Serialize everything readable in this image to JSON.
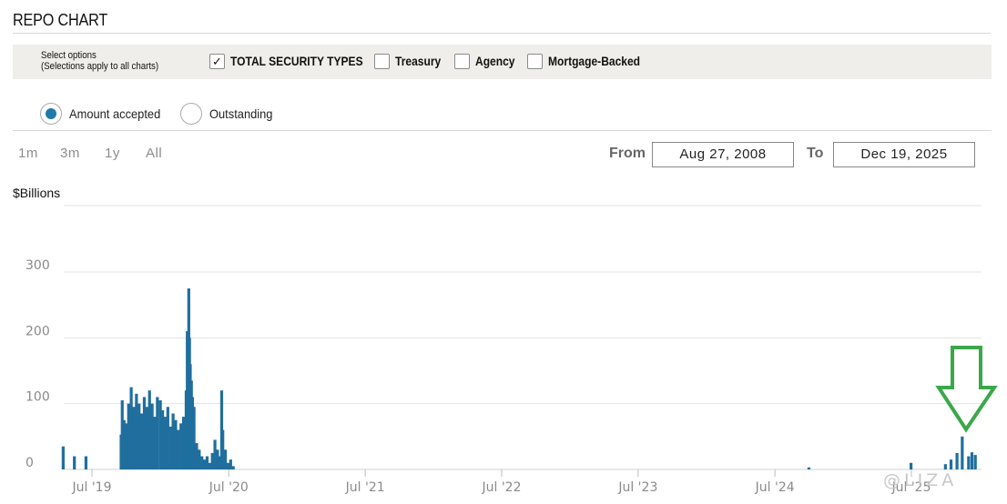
{
  "header": {
    "title": "REPO CHART"
  },
  "options": {
    "hint_line1": "Select options",
    "hint_line2": "(Selections apply to all charts)",
    "checkboxes": [
      {
        "label": "TOTAL SECURITY TYPES",
        "checked": true
      },
      {
        "label": "Treasury",
        "checked": false
      },
      {
        "label": "Agency",
        "checked": false
      },
      {
        "label": "Mortgage-Backed",
        "checked": false
      }
    ]
  },
  "view": {
    "radios": [
      {
        "label": "Amount accepted",
        "selected": true
      },
      {
        "label": "Outstanding",
        "selected": false
      }
    ]
  },
  "range": {
    "buttons": [
      "1m",
      "3m",
      "1y",
      "All"
    ],
    "from_label": "From",
    "from_value": "Aug 27, 2008",
    "to_label": "To",
    "to_value": "Dec 19, 2025"
  },
  "colors": {
    "bar": "#1f6e9e",
    "accent": "#1f7aa8",
    "arrow": "#3aa84a",
    "grid": "#e3e3e3"
  },
  "watermark": "@LIZA",
  "chart_data": {
    "type": "bar",
    "title": "",
    "ylabel": "$Billions",
    "ylim": [
      0,
      300
    ],
    "yticks": [
      0,
      100,
      200,
      300
    ],
    "x_tick_labels": [
      "Jul '19",
      "Jul '20",
      "Jul '21",
      "Jul '22",
      "Jul '23",
      "Jul '24",
      "Jul '25"
    ],
    "x_tick_dates": [
      "2019-07-01",
      "2020-07-01",
      "2021-07-01",
      "2022-07-01",
      "2023-07-01",
      "2024-07-01",
      "2025-07-01"
    ],
    "x": [
      "2019-04-15",
      "2019-05-15",
      "2019-06-15",
      "2019-09-17",
      "2019-09-20",
      "2019-09-25",
      "2019-10-01",
      "2019-10-07",
      "2019-10-14",
      "2019-10-21",
      "2019-10-28",
      "2019-11-04",
      "2019-11-11",
      "2019-11-18",
      "2019-11-25",
      "2019-12-02",
      "2019-12-09",
      "2019-12-16",
      "2019-12-23",
      "2019-12-31",
      "2020-01-06",
      "2020-01-13",
      "2020-01-20",
      "2020-01-27",
      "2020-02-03",
      "2020-02-10",
      "2020-02-17",
      "2020-02-24",
      "2020-03-02",
      "2020-03-09",
      "2020-03-12",
      "2020-03-16",
      "2020-03-18",
      "2020-03-20",
      "2020-03-23",
      "2020-03-26",
      "2020-03-30",
      "2020-04-06",
      "2020-04-13",
      "2020-04-20",
      "2020-04-27",
      "2020-05-04",
      "2020-05-11",
      "2020-05-18",
      "2020-05-25",
      "2020-06-01",
      "2020-06-08",
      "2020-06-12",
      "2020-06-15",
      "2020-06-22",
      "2020-06-29",
      "2020-07-06",
      "2020-07-13",
      "2024-09-30",
      "2025-06-30",
      "2025-09-30",
      "2025-10-15",
      "2025-10-31",
      "2025-11-14",
      "2025-12-01",
      "2025-12-10",
      "2025-12-19"
    ],
    "values": [
      35,
      20,
      20,
      53,
      105,
      75,
      70,
      100,
      125,
      95,
      115,
      100,
      85,
      110,
      95,
      120,
      100,
      80,
      110,
      105,
      90,
      80,
      95,
      65,
      85,
      75,
      60,
      70,
      80,
      120,
      210,
      275,
      200,
      160,
      135,
      110,
      95,
      40,
      30,
      20,
      15,
      20,
      10,
      25,
      45,
      30,
      20,
      120,
      60,
      30,
      10,
      15,
      5,
      3,
      10,
      8,
      15,
      25,
      50,
      20,
      26,
      22
    ]
  }
}
